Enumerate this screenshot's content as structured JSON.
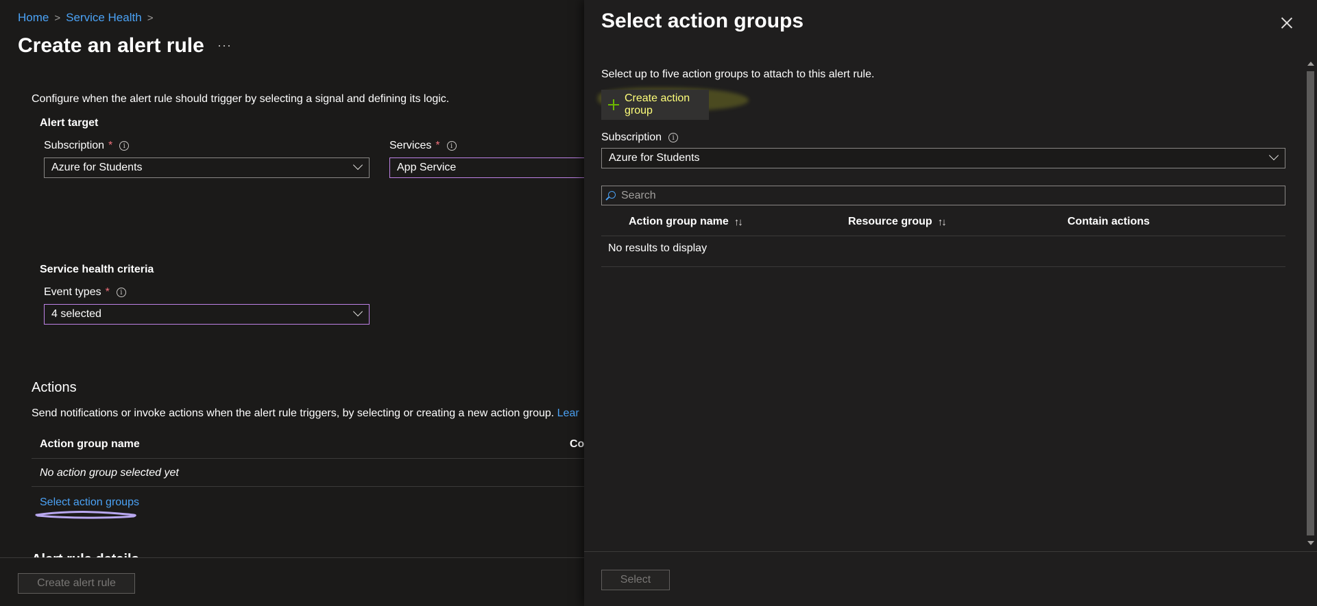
{
  "breadcrumb": {
    "items": [
      "Home",
      "Service Health"
    ]
  },
  "page": {
    "title": "Create an alert rule",
    "more_label": "···",
    "intro": "Configure when the alert rule should trigger by selecting a signal and defining its logic."
  },
  "alert_target": {
    "heading": "Alert target",
    "subscription_label": "Subscription",
    "subscription_value": "Azure for Students",
    "services_label": "Services",
    "services_value": "App Service"
  },
  "criteria": {
    "heading": "Service health criteria",
    "event_types_label": "Event types",
    "event_types_value": "4 selected"
  },
  "actions": {
    "heading": "Actions",
    "description": "Send notifications or invoke actions when the alert rule triggers, by selecting or creating a new action group. ",
    "learn_link": "Lear",
    "col_action_group_name": "Action group name",
    "col_contains": "Co",
    "empty_row": "No action group selected yet",
    "select_link": "Select action groups"
  },
  "footer": {
    "create_label": "Create alert rule"
  },
  "panel": {
    "title": "Select action groups",
    "description": "Select up to five action groups to attach to this alert rule.",
    "create_label": "Create action group",
    "subscription_label": "Subscription",
    "subscription_value": "Azure for Students",
    "search_placeholder": "Search",
    "columns": {
      "name": "Action group name",
      "resource_group": "Resource group",
      "contain_actions": "Contain actions"
    },
    "empty_text": "No results to display",
    "select_label": "Select"
  },
  "colors": {
    "background": "#1b1a19",
    "link": "#4ba2f5",
    "required": "#f1707b",
    "focus_border": "#c083e8",
    "create_text": "#ffff7a",
    "plus": "#6bb700"
  },
  "icons": {
    "info": "info-icon",
    "chevron": "chevron-down-icon",
    "close": "close-icon",
    "plus": "plus-icon",
    "search": "search-icon",
    "sort": "sort-icon"
  }
}
